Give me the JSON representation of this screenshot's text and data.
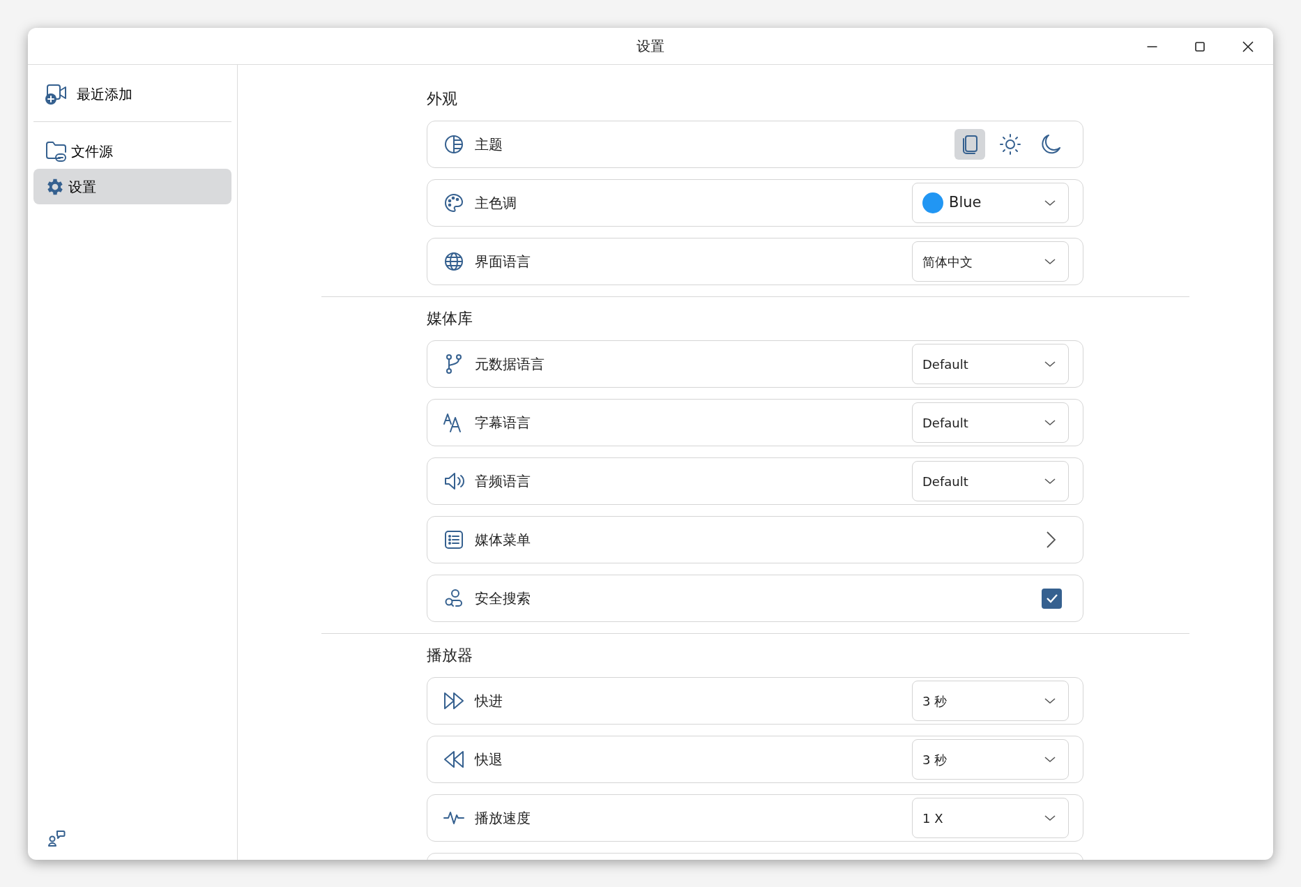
{
  "window": {
    "title": "设置"
  },
  "sidebar": {
    "items": [
      {
        "label": "最近添加",
        "selected": false
      },
      {
        "label": "文件源",
        "selected": false
      },
      {
        "label": "设置",
        "selected": true
      }
    ]
  },
  "sections": [
    {
      "title": "外观",
      "rows": [
        {
          "kind": "theme",
          "label": "主题",
          "options": [
            {
              "selected": true
            },
            {
              "selected": false
            },
            {
              "selected": false
            }
          ]
        },
        {
          "kind": "select",
          "label": "主色调",
          "value": "Blue",
          "color": "#2196f3"
        },
        {
          "kind": "select",
          "label": "界面语言",
          "value": "简体中文"
        }
      ]
    },
    {
      "title": "媒体库",
      "rows": [
        {
          "kind": "select",
          "label": "元数据语言",
          "value": "Default"
        },
        {
          "kind": "select",
          "label": "字幕语言",
          "value": "Default"
        },
        {
          "kind": "select",
          "label": "音频语言",
          "value": "Default"
        },
        {
          "kind": "link",
          "label": "媒体菜单"
        },
        {
          "kind": "checkbox",
          "label": "安全搜索",
          "checked": true
        }
      ]
    },
    {
      "title": "播放器",
      "rows": [
        {
          "kind": "select",
          "label": "快进",
          "value": "3 秒"
        },
        {
          "kind": "select",
          "label": "快退",
          "value": "3 秒"
        },
        {
          "kind": "select",
          "label": "播放速度",
          "value": "1 X"
        },
        {
          "kind": "partial"
        }
      ]
    }
  ]
}
